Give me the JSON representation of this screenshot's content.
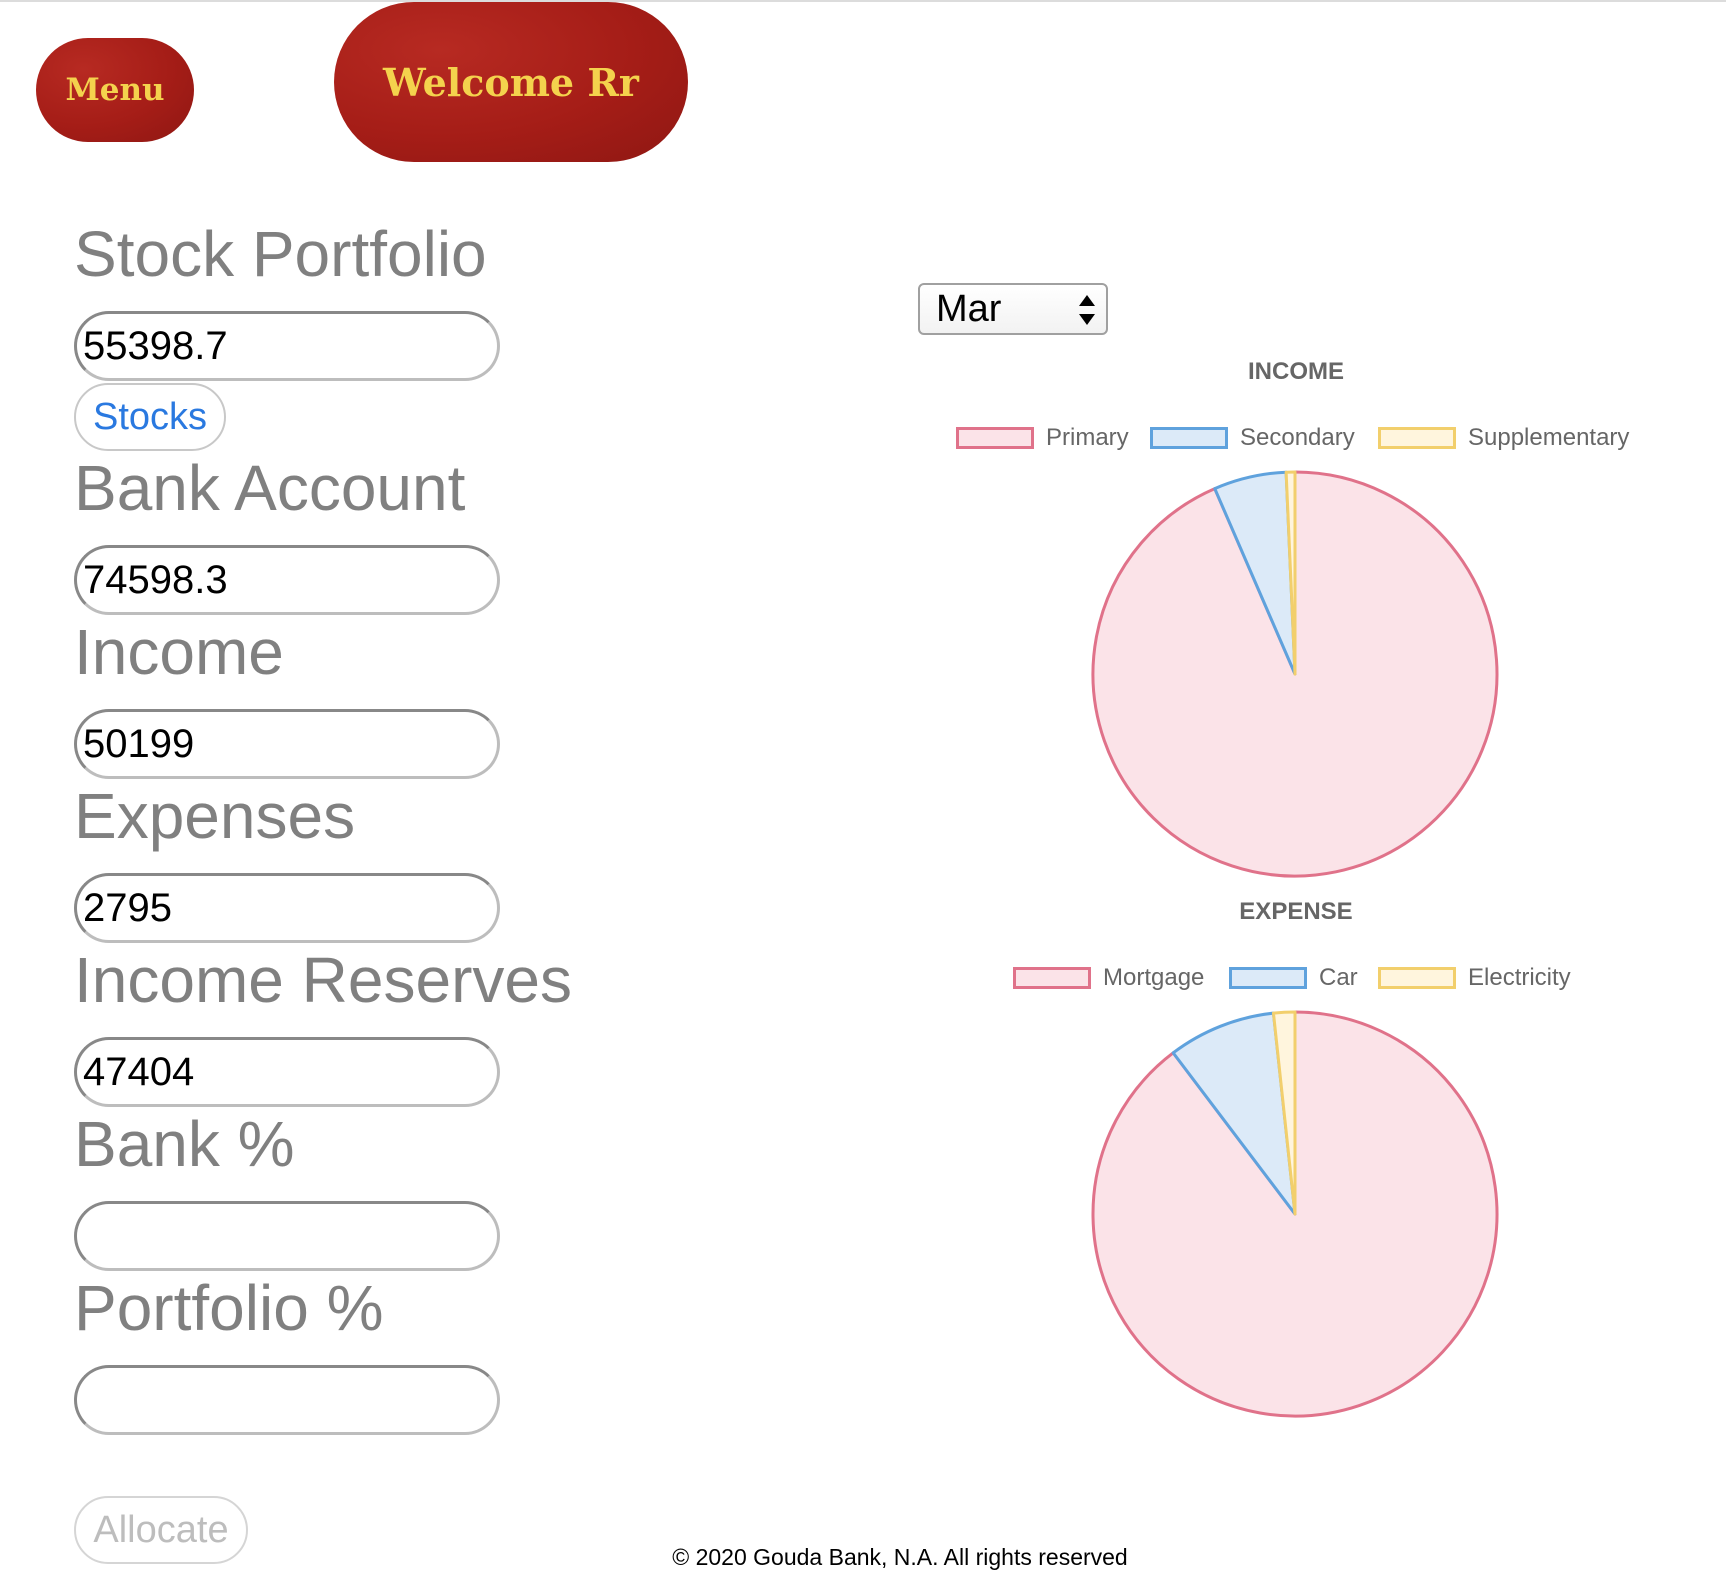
{
  "header": {
    "menu_label": "Menu",
    "welcome_label": "Welcome Rr"
  },
  "form": {
    "stock_portfolio": {
      "label": "Stock Portfolio",
      "value": "55398.7"
    },
    "stocks_button": "Stocks",
    "bank_account": {
      "label": "Bank Account",
      "value": "74598.3"
    },
    "income": {
      "label": "Income",
      "value": "50199"
    },
    "expenses": {
      "label": "Expenses",
      "value": "2795"
    },
    "income_reserves": {
      "label": "Income Reserves",
      "value": "47404"
    },
    "bank_percent": {
      "label": "Bank %",
      "value": ""
    },
    "portfolio_percent": {
      "label": "Portfolio %",
      "value": ""
    },
    "allocate_button": "Allocate"
  },
  "month_select": {
    "selected": "Mar"
  },
  "chart_data": [
    {
      "type": "pie",
      "title": "INCOME",
      "legend_position": "top",
      "labels": [
        "Primary",
        "Secondary",
        "Supplementary"
      ],
      "values": [
        93.5,
        5.8,
        0.7
      ],
      "colors": {
        "fill": [
          "#fbe3e8",
          "#dceaf8",
          "#fff5dd"
        ],
        "border": [
          "#e0728a",
          "#5fa2dd",
          "#f2cf6c"
        ]
      }
    },
    {
      "type": "pie",
      "title": "EXPENSE",
      "legend_position": "top",
      "labels": [
        "Mortgage",
        "Car",
        "Electricity"
      ],
      "values": [
        89.7,
        8.6,
        1.7
      ],
      "colors": {
        "fill": [
          "#fbe3e8",
          "#dceaf8",
          "#fff5dd"
        ],
        "border": [
          "#e0728a",
          "#5fa2dd",
          "#f2cf6c"
        ]
      }
    }
  ],
  "footer": {
    "copyright": "© 2020 Gouda Bank, N.A. All rights reserved"
  }
}
